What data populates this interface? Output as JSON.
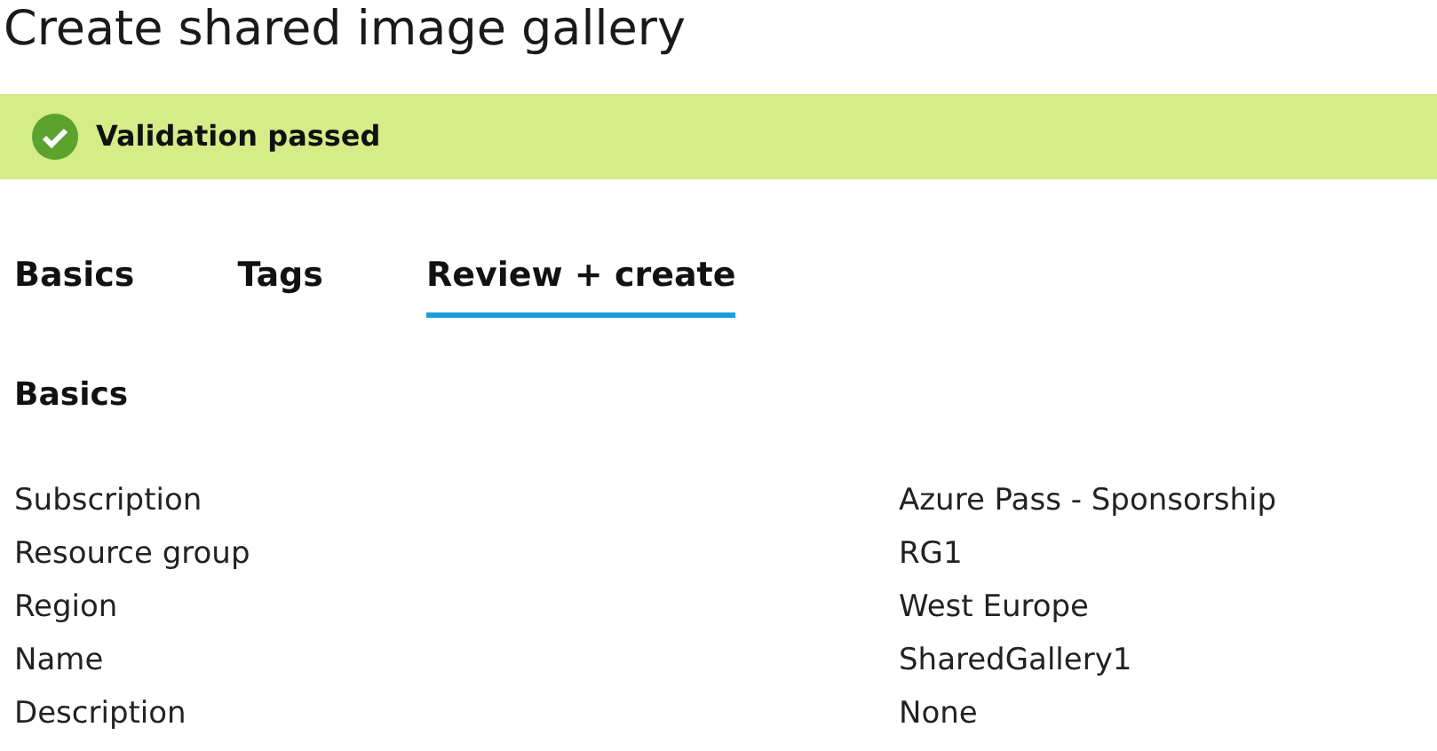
{
  "title": "Create shared image gallery",
  "banner": {
    "kind": "success",
    "text": "Validation passed"
  },
  "tabs": [
    {
      "label": "Basics",
      "selected": false
    },
    {
      "label": "Tags",
      "selected": false
    },
    {
      "label": "Review + create",
      "selected": true
    }
  ],
  "section": {
    "heading": "Basics",
    "rows": [
      {
        "label": "Subscription",
        "value": "Azure Pass - Sponsorship"
      },
      {
        "label": "Resource group",
        "value": "RG1"
      },
      {
        "label": "Region",
        "value": "West Europe"
      },
      {
        "label": "Name",
        "value": "SharedGallery1"
      },
      {
        "label": "Description",
        "value": "None"
      }
    ]
  }
}
